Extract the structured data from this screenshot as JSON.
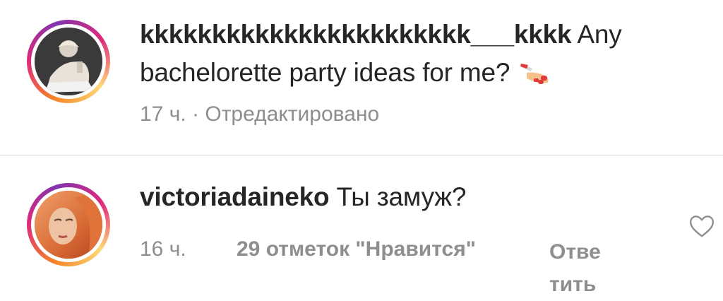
{
  "comments": [
    {
      "username": "kkkkkkkkkkkkkkkkkkkkkkk___kkkk",
      "text_inline": "Any",
      "text_line2": "bachelorette party ideas for me?",
      "emoji": "nail-polish-emoji",
      "time": "17 ч.",
      "separator": "·",
      "edited": "Отредактировано",
      "avatar": "profile-photo"
    },
    {
      "username": "victoriadaineko",
      "text": "Ты замуж?",
      "time": "16 ч.",
      "likes": "29 отметок \"Нравится\"",
      "reply": "Ответить",
      "like_icon": "heart-outline-icon",
      "avatar": "profile-photo"
    }
  ],
  "colors": {
    "text": "#262626",
    "meta": "#8e8e8e",
    "divider": "#e6e6e6",
    "ring_gradient": [
      "#f58529",
      "#dd2a7b",
      "#8134af",
      "#feda77"
    ]
  }
}
